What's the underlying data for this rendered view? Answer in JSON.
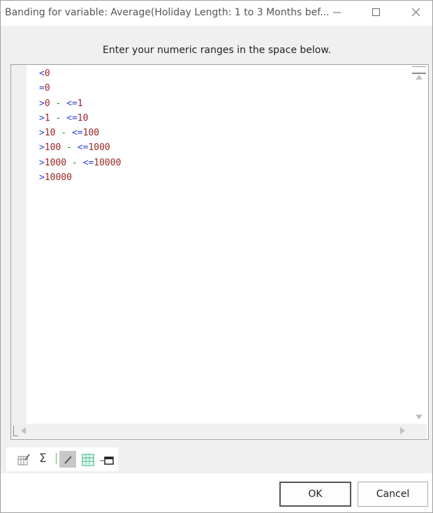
{
  "window": {
    "title": "Banding for variable: Average(Holiday Length: 1 to 3 Months bef...",
    "controls": [
      "minimize-icon",
      "maximize-icon",
      "close-icon"
    ]
  },
  "prompt": "Enter your numeric ranges in the space below.",
  "ranges": [
    [
      {
        "t": "<",
        "c": "op"
      },
      {
        "t": "0",
        "c": "num"
      }
    ],
    [
      {
        "t": "=",
        "c": "op"
      },
      {
        "t": "0",
        "c": "num"
      }
    ],
    [
      {
        "t": ">",
        "c": "op"
      },
      {
        "t": "0",
        "c": "num"
      },
      {
        "t": " - ",
        "c": "dash"
      },
      {
        "t": "<=",
        "c": "op"
      },
      {
        "t": "1",
        "c": "num"
      }
    ],
    [
      {
        "t": ">",
        "c": "op"
      },
      {
        "t": "1",
        "c": "num"
      },
      {
        "t": " - ",
        "c": "dash"
      },
      {
        "t": "<=",
        "c": "op"
      },
      {
        "t": "10",
        "c": "num"
      }
    ],
    [
      {
        "t": ">",
        "c": "op"
      },
      {
        "t": "10",
        "c": "num"
      },
      {
        "t": " - ",
        "c": "dash"
      },
      {
        "t": "<=",
        "c": "op"
      },
      {
        "t": "100",
        "c": "num"
      }
    ],
    [
      {
        "t": ">",
        "c": "op"
      },
      {
        "t": "100",
        "c": "num"
      },
      {
        "t": " - ",
        "c": "dash"
      },
      {
        "t": "<=",
        "c": "op"
      },
      {
        "t": "1000",
        "c": "num"
      }
    ],
    [
      {
        "t": ">",
        "c": "op"
      },
      {
        "t": "1000",
        "c": "num"
      },
      {
        "t": " - ",
        "c": "dash"
      },
      {
        "t": "<=",
        "c": "op"
      },
      {
        "t": "10000",
        "c": "num"
      }
    ],
    [
      {
        "t": ">",
        "c": "op"
      },
      {
        "t": "10000",
        "c": "num"
      }
    ]
  ],
  "toolbar": {
    "tools": [
      "table-edit-icon",
      "sum-icon",
      "edit-pencil-icon",
      "grid-icon",
      "insert-panel-icon"
    ],
    "sum_symbol": "Σ"
  },
  "buttons": {
    "ok": "OK",
    "cancel": "Cancel"
  },
  "colors": {
    "operator": "#3344d6",
    "number": "#9a2424",
    "separator": "#0a8a0a"
  }
}
